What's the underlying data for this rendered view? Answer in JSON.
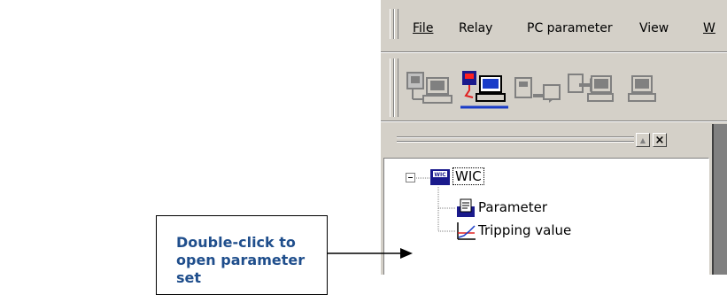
{
  "menu": {
    "items": [
      {
        "label": "File",
        "key": "F"
      },
      {
        "label": "Relay",
        "key": "R"
      },
      {
        "label": "PC parameter",
        "key": ""
      },
      {
        "label": "View",
        "key": "V"
      },
      {
        "label": "W",
        "key": "W"
      }
    ]
  },
  "toolbar": {
    "buttons": [
      {
        "icon": "disconnected-computer-icon",
        "state": "disabled"
      },
      {
        "icon": "connect-relay-icon",
        "state": "active"
      },
      {
        "icon": "download-to-relay-icon",
        "state": "disabled"
      },
      {
        "icon": "upload-from-relay-icon",
        "state": "disabled"
      },
      {
        "icon": "computer-icon",
        "state": "disabled"
      }
    ]
  },
  "panel": {
    "restore_glyph": "▲",
    "close_glyph": "×"
  },
  "tree": {
    "expander": "⊟",
    "root": {
      "label": "WIC",
      "icon_text": "WIC"
    },
    "children": [
      {
        "label": "Parameter",
        "icon": "parameter-icon"
      },
      {
        "label": "Tripping value",
        "icon": "tripping-curve-icon"
      }
    ]
  },
  "callout": {
    "text": "Double-click to open parameter set"
  }
}
